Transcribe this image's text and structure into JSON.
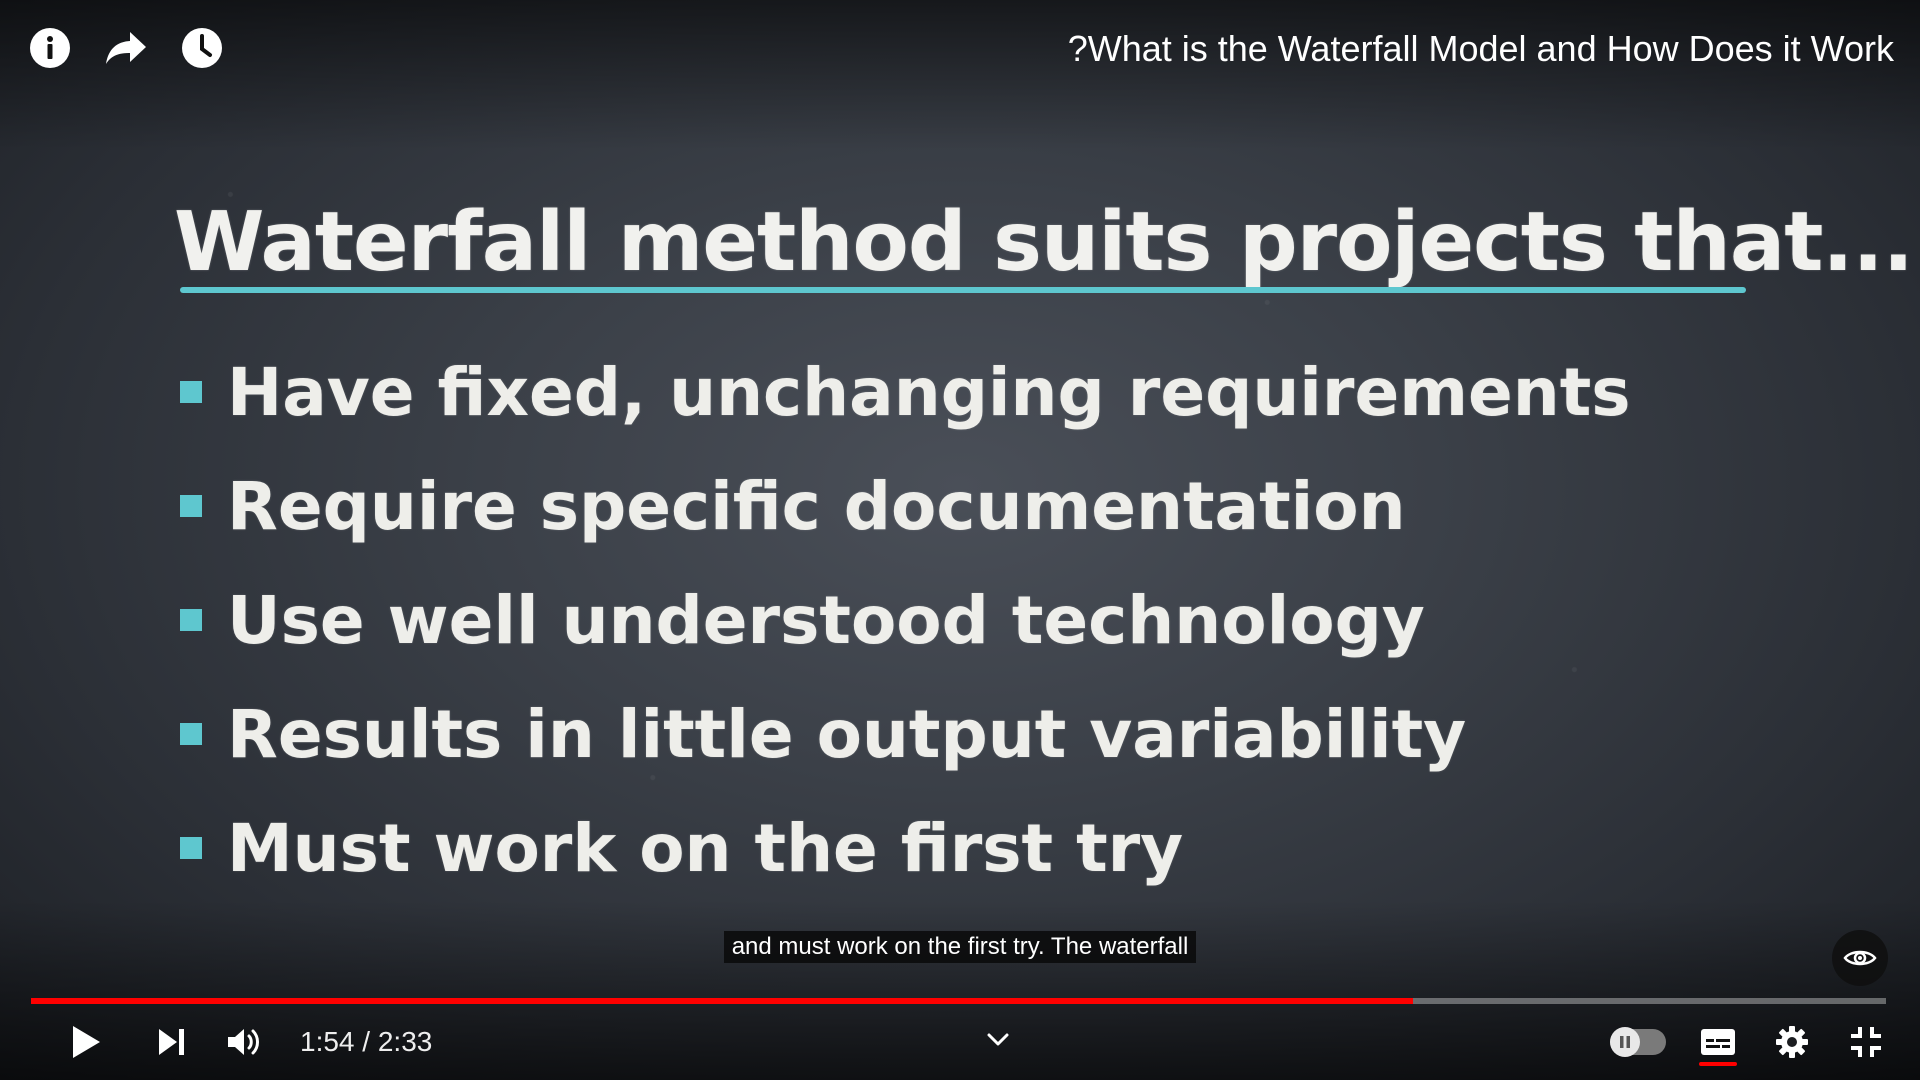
{
  "header": {
    "title": "?What is the Waterfall Model and How Does it Work",
    "icons": [
      "info-icon",
      "share-icon",
      "watch-later-icon"
    ]
  },
  "slide": {
    "heading": "Waterfall method suits projects that...",
    "bullets": [
      "Have fixed, unchanging requirements",
      "Require specific documentation",
      "Use well understood technology",
      "Results in little output variability",
      "Must work on the first try"
    ],
    "accent_color": "#5ec7cf"
  },
  "caption": {
    "text": "and must work on the first try. The waterfall"
  },
  "player": {
    "current_time": "1:54",
    "separator": " / ",
    "duration": "2:33",
    "progress_fraction": 0.745,
    "progress_color": "#ff0000",
    "autoplay_enabled": false,
    "captions_enabled": true,
    "controls": [
      "play-icon",
      "next-icon",
      "volume-icon",
      "chevron-down-icon",
      "autoplay-toggle",
      "subtitles-icon",
      "settings-icon",
      "exit-fullscreen-icon",
      "eye-icon"
    ]
  }
}
